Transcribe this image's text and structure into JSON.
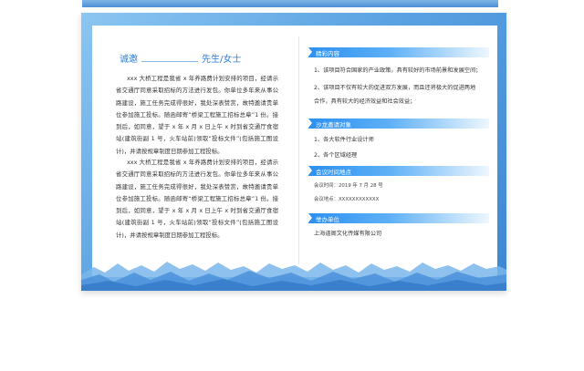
{
  "greeting": {
    "prefix": "诚邀",
    "suffix": "先生/女士"
  },
  "letter": {
    "paragraphs": [
      "xxx 大桥工程是我省 x 年养路费计划安排的项目，经请示省交通厅同意采取招标的方法进行发包。你单位多年来从事公路建设，施工任务完成得很好，我处深表赞赏，故特邀请贵单位参加施工投标。随函邮寄“桥梁工程施工招标总章”1 份。接到后，如同意，望于 x 年 x 月 x 日上午 x 时到省交通厅食宿站(建筑街副 1 号，火车站前)领取“投标文件”(包括施工图设计)，并请按规章制度日期参加工程投标。",
      "xxx 大桥工程是我省 x 年养路费计划安排的项目，经请示省交通厅同意采取招标的方法进行发包。你单位多年来从事公路建设，施工任务完成得很好，我处深表赞赏，故特邀请贵单位参加施工投标。随函邮寄“桥梁工程施工招标总章”1 份。接到后，如同意，望于 x 年 x 月 x 日上午 x 时到省交通厅食宿站(建筑街副 1 号，火车站前)领取“投标文件”(包括施工图设计)，并请按规章制度日期参加工程投标。"
    ]
  },
  "sections": {
    "highlights": {
      "title": "精彩内容",
      "items": [
        "1、该项目符合国家的产业政策，具有较好的市场前景和发展空间；",
        "2、该项目不仅有较大的促进双方发展，而且还将极大的促进两地",
        "合作，具有较大的经济效益和社会效益；"
      ]
    },
    "targets": {
      "title": "沙龙邀请对象",
      "items": [
        "1、各大软件行业设计师",
        "2、各个区域经理"
      ]
    },
    "meeting": {
      "title": "会议时间地点",
      "time": "会议时间：2019 年 7 月 28 号",
      "place": "会议地点：XXXXXXXXXXXX"
    },
    "organizer": {
      "title": "举办单位",
      "name": "上海道阁文化传媒有限公司"
    }
  },
  "colors": {
    "accent": "#2c8ff0",
    "frame": "#5aa2e2",
    "greeting_text": "#2d7fd3",
    "body_text": "#333333"
  }
}
